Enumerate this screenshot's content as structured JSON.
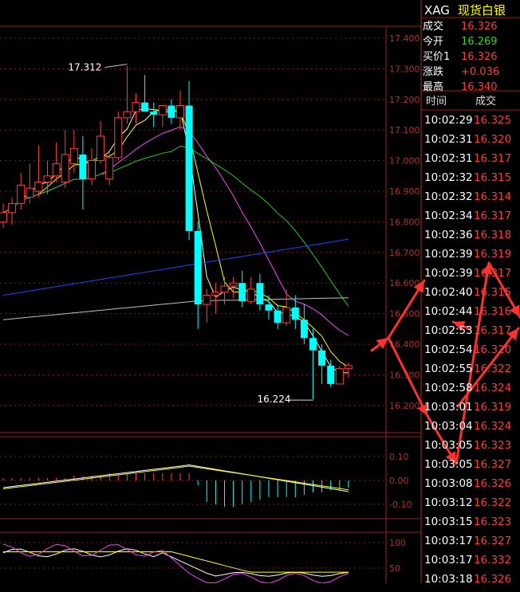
{
  "instrument": {
    "code": "XAG",
    "name": "现货白银"
  },
  "quote": [
    {
      "label": "成交",
      "value": "16.326",
      "color": "#ff3b3b"
    },
    {
      "label": "今开",
      "value": "16.269",
      "color": "#22dd22"
    },
    {
      "label": "买价1",
      "value": "16.326",
      "color": "#ff3b3b"
    },
    {
      "label": "涨跌",
      "value": "+0.036",
      "color": "#ff3b3b"
    },
    {
      "label": "最高",
      "value": "16.340",
      "color": "#ff3b3b"
    }
  ],
  "ticks": {
    "header_time": "时间",
    "header_price": "成交",
    "rows": [
      {
        "time": "10:02:29",
        "price": "16.325"
      },
      {
        "time": "10:02:31",
        "price": "16.320"
      },
      {
        "time": "10:02:31",
        "price": "16.317"
      },
      {
        "time": "10:02:32",
        "price": "16.315"
      },
      {
        "time": "10:02:32",
        "price": "16.314"
      },
      {
        "time": "10:02:34",
        "price": "16.317"
      },
      {
        "time": "10:02:36",
        "price": "16.318"
      },
      {
        "time": "10:02:39",
        "price": "16.319"
      },
      {
        "time": "10:02:39",
        "price": "16.317"
      },
      {
        "time": "10:02:40",
        "price": "16.315"
      },
      {
        "time": "10:02:44",
        "price": "16.316"
      },
      {
        "time": "10:02:53",
        "price": "16.317"
      },
      {
        "time": "10:02:54",
        "price": "16.320"
      },
      {
        "time": "10:02:55",
        "price": "16.322"
      },
      {
        "time": "10:02:58",
        "price": "16.324"
      },
      {
        "time": "10:03:01",
        "price": "16.319"
      },
      {
        "time": "10:03:04",
        "price": "16.324"
      },
      {
        "time": "10:03:05",
        "price": "16.323"
      },
      {
        "time": "10:03:05",
        "price": "16.327"
      },
      {
        "time": "10:03:08",
        "price": "16.326"
      },
      {
        "time": "10:03:12",
        "price": "16.322"
      },
      {
        "time": "10:03:15",
        "price": "16.323"
      },
      {
        "time": "10:03:17",
        "price": "16.327"
      },
      {
        "time": "10:03:17",
        "price": "16.332"
      },
      {
        "time": "10:03:18",
        "price": "16.326"
      }
    ]
  },
  "chart_data": {
    "type": "candlestick",
    "y_axis_labels": [
      "17.400",
      "17.300",
      "17.200",
      "17.100",
      "17.000",
      "16.900",
      "16.800",
      "16.700",
      "16.600",
      "16.500",
      "16.400",
      "16.300",
      "16.200"
    ],
    "ylim": [
      16.16,
      17.43
    ],
    "annotations": [
      {
        "text": "17.312"
      },
      {
        "text": "16.224"
      }
    ],
    "up_color": "#ff4040",
    "down_color": "#00ffff",
    "candles": [
      {
        "open": 16.8,
        "high": 16.86,
        "low": 16.78,
        "close": 16.83
      },
      {
        "open": 16.83,
        "high": 16.88,
        "low": 16.79,
        "close": 16.86
      },
      {
        "open": 16.86,
        "high": 16.96,
        "low": 16.84,
        "close": 16.92
      },
      {
        "open": 16.88,
        "high": 16.99,
        "low": 16.86,
        "close": 16.91
      },
      {
        "open": 16.9,
        "high": 17.05,
        "low": 16.88,
        "close": 16.93
      },
      {
        "open": 16.93,
        "high": 17.0,
        "low": 16.89,
        "close": 16.95
      },
      {
        "open": 16.95,
        "high": 17.06,
        "low": 16.93,
        "close": 16.99
      },
      {
        "open": 16.93,
        "high": 17.1,
        "low": 16.91,
        "close": 17.02
      },
      {
        "open": 16.99,
        "high": 17.1,
        "low": 16.96,
        "close": 17.04
      },
      {
        "open": 17.02,
        "high": 17.08,
        "low": 16.84,
        "close": 16.94
      },
      {
        "open": 16.94,
        "high": 17.04,
        "low": 16.92,
        "close": 17.0
      },
      {
        "open": 17.0,
        "high": 17.13,
        "low": 16.99,
        "close": 17.08
      },
      {
        "open": 16.94,
        "high": 17.03,
        "low": 16.92,
        "close": 17.01
      },
      {
        "open": 17.01,
        "high": 17.16,
        "low": 17.0,
        "close": 17.14
      },
      {
        "open": 17.14,
        "high": 17.31,
        "low": 17.12,
        "close": 17.16
      },
      {
        "open": 17.16,
        "high": 17.22,
        "low": 17.12,
        "close": 17.19
      },
      {
        "open": 17.19,
        "high": 17.28,
        "low": 17.16,
        "close": 17.16
      },
      {
        "open": 17.16,
        "high": 17.19,
        "low": 17.11,
        "close": 17.15
      },
      {
        "open": 17.15,
        "high": 17.18,
        "low": 17.11,
        "close": 17.18
      },
      {
        "open": 17.18,
        "high": 17.2,
        "low": 17.12,
        "close": 17.14
      },
      {
        "open": 17.14,
        "high": 17.23,
        "low": 17.1,
        "close": 17.18
      },
      {
        "open": 17.18,
        "high": 17.26,
        "low": 16.74,
        "close": 16.77
      },
      {
        "open": 16.77,
        "high": 16.8,
        "low": 16.45,
        "close": 16.53
      },
      {
        "open": 16.53,
        "high": 16.58,
        "low": 16.47,
        "close": 16.56
      },
      {
        "open": 16.56,
        "high": 16.6,
        "low": 16.5,
        "close": 16.57
      },
      {
        "open": 16.57,
        "high": 16.62,
        "low": 16.53,
        "close": 16.59
      },
      {
        "open": 16.59,
        "high": 16.62,
        "low": 16.55,
        "close": 16.6
      },
      {
        "open": 16.6,
        "high": 16.64,
        "low": 16.52,
        "close": 16.54
      },
      {
        "open": 16.54,
        "high": 16.62,
        "low": 16.53,
        "close": 16.58
      },
      {
        "open": 16.6,
        "high": 16.63,
        "low": 16.51,
        "close": 16.53
      },
      {
        "open": 16.53,
        "high": 16.56,
        "low": 16.48,
        "close": 16.51
      },
      {
        "open": 16.51,
        "high": 16.53,
        "low": 16.45,
        "close": 16.47
      },
      {
        "open": 16.47,
        "high": 16.58,
        "low": 16.46,
        "close": 16.52
      },
      {
        "open": 16.52,
        "high": 16.56,
        "low": 16.45,
        "close": 16.48
      },
      {
        "open": 16.48,
        "high": 16.53,
        "low": 16.4,
        "close": 16.42
      },
      {
        "open": 16.42,
        "high": 16.45,
        "low": 16.22,
        "close": 16.38
      },
      {
        "open": 16.38,
        "high": 16.4,
        "low": 16.27,
        "close": 16.33
      },
      {
        "open": 16.33,
        "high": 16.35,
        "low": 16.26,
        "close": 16.27
      },
      {
        "open": 16.27,
        "high": 16.33,
        "low": 16.28,
        "close": 16.32
      },
      {
        "open": 16.32,
        "high": 16.34,
        "low": 16.29,
        "close": 16.33
      }
    ],
    "moving_averages": [
      {
        "name": "",
        "color": "#ffffc0"
      },
      {
        "name": "",
        "color": "#ffff00"
      },
      {
        "name": "",
        "color": "#ff40ff"
      },
      {
        "name": "",
        "color": "#22cc22"
      },
      {
        "name": "",
        "color": "#2244ff"
      },
      {
        "name": "",
        "color": "#c0c0c0"
      }
    ],
    "macd": {
      "y_axis_labels": [
        "0.10",
        "0.00",
        "-0.10"
      ],
      "ylim": [
        -0.14,
        0.13
      ],
      "hist": [
        0.01,
        0.01,
        0.01,
        0.01,
        0.01,
        0.01,
        0.01,
        0.01,
        0.02,
        0.02,
        0.02,
        0.02,
        0.03,
        0.03,
        0.03,
        0.03,
        0.03,
        0.03,
        0.03,
        0.03,
        0.03,
        0.03,
        -0.02,
        -0.09,
        -0.1,
        -0.11,
        -0.11,
        -0.1,
        -0.09,
        -0.08,
        -0.07,
        -0.07,
        -0.07,
        -0.07,
        -0.06,
        -0.05,
        -0.05,
        -0.04,
        -0.04,
        -0.03
      ]
    },
    "kdj": {
      "y_axis_labels": [
        "100",
        "50"
      ],
      "ylim": [
        35,
        110
      ]
    }
  }
}
